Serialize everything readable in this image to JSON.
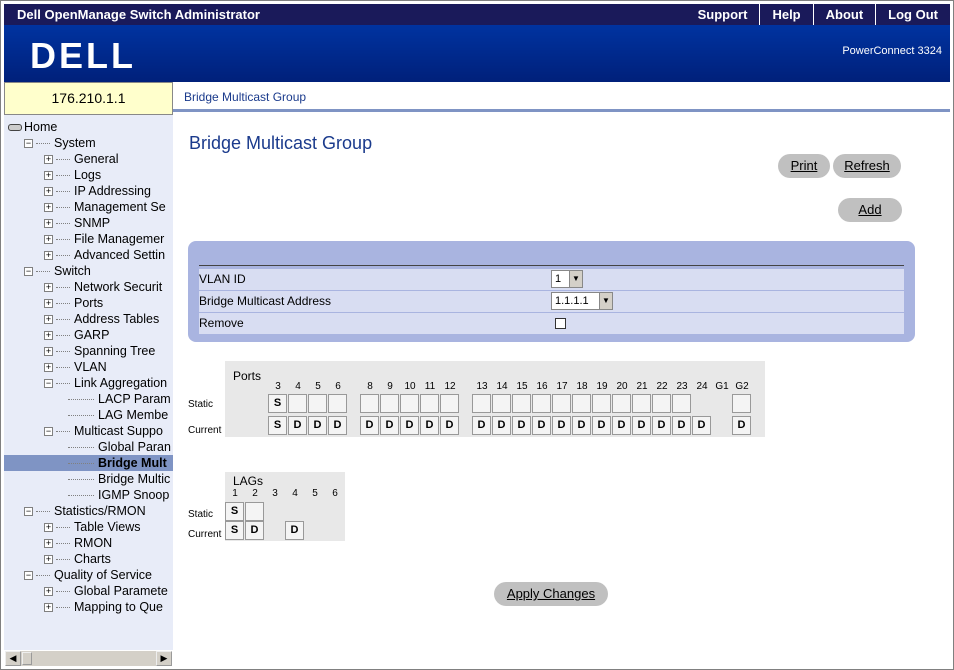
{
  "topbar": {
    "title": "Dell OpenManage Switch Administrator",
    "links": [
      "Support",
      "Help",
      "About",
      "Log Out"
    ]
  },
  "banner": {
    "logo": "DELL",
    "model": "PowerConnect 3324"
  },
  "ip": "176.210.1.1",
  "breadcrumb": "Bridge Multicast Group",
  "tree": [
    {
      "label": "Home",
      "level": 0,
      "expander": ""
    },
    {
      "label": "System",
      "level": 1,
      "expander": "-"
    },
    {
      "label": "General",
      "level": 2,
      "expander": "+"
    },
    {
      "label": "Logs",
      "level": 2,
      "expander": "+"
    },
    {
      "label": "IP Addressing",
      "level": 2,
      "expander": "+"
    },
    {
      "label": "Management Se",
      "level": 2,
      "expander": "+"
    },
    {
      "label": "SNMP",
      "level": 2,
      "expander": "+"
    },
    {
      "label": "File Managemer",
      "level": 2,
      "expander": "+"
    },
    {
      "label": "Advanced Settin",
      "level": 2,
      "expander": "+"
    },
    {
      "label": "Switch",
      "level": 1,
      "expander": "-"
    },
    {
      "label": "Network Securit",
      "level": 2,
      "expander": "+"
    },
    {
      "label": "Ports",
      "level": 2,
      "expander": "+"
    },
    {
      "label": "Address Tables",
      "level": 2,
      "expander": "+"
    },
    {
      "label": "GARP",
      "level": 2,
      "expander": "+"
    },
    {
      "label": "Spanning Tree",
      "level": 2,
      "expander": "+"
    },
    {
      "label": "VLAN",
      "level": 2,
      "expander": "+"
    },
    {
      "label": "Link Aggregation",
      "level": 2,
      "expander": "-"
    },
    {
      "label": "LACP Param",
      "level": 3,
      "expander": ""
    },
    {
      "label": "LAG Membe",
      "level": 3,
      "expander": ""
    },
    {
      "label": "Multicast Suppo",
      "level": 2,
      "expander": "-"
    },
    {
      "label": "Global Paran",
      "level": 3,
      "expander": ""
    },
    {
      "label": "Bridge Mult",
      "level": 3,
      "expander": "",
      "selected": true
    },
    {
      "label": "Bridge Multic",
      "level": 3,
      "expander": ""
    },
    {
      "label": "IGMP Snoop",
      "level": 3,
      "expander": ""
    },
    {
      "label": "Statistics/RMON",
      "level": 1,
      "expander": "-"
    },
    {
      "label": "Table Views",
      "level": 2,
      "expander": "+"
    },
    {
      "label": "RMON",
      "level": 2,
      "expander": "+"
    },
    {
      "label": "Charts",
      "level": 2,
      "expander": "+"
    },
    {
      "label": "Quality of Service",
      "level": 1,
      "expander": "-"
    },
    {
      "label": "Global Paramete",
      "level": 2,
      "expander": "+"
    },
    {
      "label": "Mapping to Que",
      "level": 2,
      "expander": "+"
    }
  ],
  "page": {
    "title": "Bridge Multicast Group",
    "print_label": "Print",
    "refresh_label": "Refresh",
    "add_label": "Add",
    "apply_label": "Apply Changes"
  },
  "form": {
    "vlan_label": "VLAN ID",
    "vlan_value": "1",
    "mcast_label": "Bridge Multicast Address",
    "mcast_value": "1.1.1.1",
    "remove_label": "Remove"
  },
  "ports": {
    "title": "Ports",
    "static_label": "Static",
    "current_label": "Current",
    "columns": [
      "3",
      "4",
      "5",
      "6",
      "",
      "8",
      "9",
      "10",
      "11",
      "12",
      "",
      "13",
      "14",
      "15",
      "16",
      "17",
      "18",
      "19",
      "20",
      "21",
      "22",
      "23",
      "24",
      "G1",
      "G2"
    ],
    "static": [
      "S",
      "",
      "",
      "",
      "",
      "",
      "",
      "",
      "",
      "",
      "",
      "",
      "",
      "",
      "",
      "",
      "",
      "",
      "",
      "",
      "",
      "",
      "",
      "",
      ""
    ],
    "current": [
      "S",
      "D",
      "D",
      "D",
      "",
      "D",
      "D",
      "D",
      "D",
      "D",
      "",
      "D",
      "D",
      "D",
      "D",
      "D",
      "D",
      "D",
      "D",
      "D",
      "D",
      "D",
      "D",
      "",
      "D"
    ]
  },
  "lags": {
    "title": "LAGs",
    "static_label": "Static",
    "current_label": "Current",
    "columns": [
      "1",
      "2",
      "3",
      "4",
      "5",
      "6"
    ],
    "static": [
      "S",
      "",
      "",
      "",
      "",
      ""
    ],
    "current": [
      "S",
      "D",
      "",
      "D",
      "",
      ""
    ]
  }
}
